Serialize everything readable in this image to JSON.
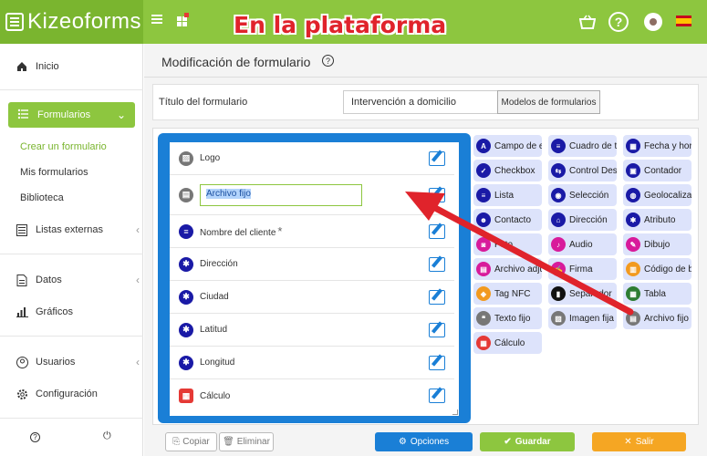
{
  "header": {
    "logo_text": "Kizeoforms",
    "overlay_title": "En la plataforma",
    "help_icon_label": "?"
  },
  "sidebar": {
    "items": [
      {
        "label": "Inicio",
        "icon": "home-icon"
      },
      {
        "label": "Formularios",
        "icon": "list-icon",
        "active": true
      },
      {
        "label": "Listas externas",
        "icon": "external-list-icon"
      },
      {
        "label": "Datos",
        "icon": "data-icon"
      },
      {
        "label": "Gráficos",
        "icon": "chart-icon"
      },
      {
        "label": "Usuarios",
        "icon": "user-icon"
      },
      {
        "label": "Configuración",
        "icon": "gear-icon"
      }
    ],
    "subitems": [
      "Crear un formulario",
      "Mis formularios",
      "Biblioteca"
    ],
    "footer_help": "?",
    "footer_power": "⏻"
  },
  "main": {
    "page_title": "Modificación de formulario",
    "form_title_label": "Título del formulario",
    "form_title_value": "Intervención a domicilio",
    "models_button": "Modelos de formularios"
  },
  "form_fields": [
    {
      "label": "Logo",
      "icon": "image-icon",
      "color": "#777777"
    },
    {
      "label": "Archivo fijo",
      "icon": "file-icon",
      "color": "#777777",
      "editing": true
    },
    {
      "label": "Nombre del cliente",
      "icon": "list-icon",
      "color": "#1a1aa6",
      "required": true,
      "required_mark": "*"
    },
    {
      "label": "Dirección",
      "icon": "asterisk-icon",
      "color": "#1a1aa6"
    },
    {
      "label": "Ciudad",
      "icon": "asterisk-icon",
      "color": "#1a1aa6"
    },
    {
      "label": "Latitud",
      "icon": "asterisk-icon",
      "color": "#1a1aa6"
    },
    {
      "label": "Longitud",
      "icon": "asterisk-icon",
      "color": "#1a1aa6"
    },
    {
      "label": "Cálculo",
      "icon": "calculator-icon",
      "color": "#e53935"
    }
  ],
  "palette": [
    {
      "label": "Campo de en",
      "icon": "text-icon",
      "color": "#1a1aa6",
      "glyph": "A"
    },
    {
      "label": "Cuadro de te",
      "icon": "textarea-icon",
      "color": "#1a1aa6",
      "glyph": "≡"
    },
    {
      "label": "Fecha y hora",
      "icon": "calendar-icon",
      "color": "#1a1aa6",
      "glyph": "▦"
    },
    {
      "label": "Checkbox",
      "icon": "checkbox-icon",
      "color": "#1a1aa6",
      "glyph": "✓"
    },
    {
      "label": "Control Desli",
      "icon": "slider-icon",
      "color": "#1a1aa6",
      "glyph": "⇆"
    },
    {
      "label": "Contador",
      "icon": "counter-icon",
      "color": "#1a1aa6",
      "glyph": "▣"
    },
    {
      "label": "Lista",
      "icon": "list-icon",
      "color": "#1a1aa6",
      "glyph": "≡"
    },
    {
      "label": "Selección",
      "icon": "select-icon",
      "color": "#1a1aa6",
      "glyph": "◉"
    },
    {
      "label": "Geolocalizaci",
      "icon": "globe-icon",
      "color": "#1a1aa6",
      "glyph": "◍"
    },
    {
      "label": "Contacto",
      "icon": "contact-icon",
      "color": "#1a1aa6",
      "glyph": "☻"
    },
    {
      "label": "Dirección",
      "icon": "address-icon",
      "color": "#1a1aa6",
      "glyph": "⌂"
    },
    {
      "label": "Atributo",
      "icon": "attribute-icon",
      "color": "#1a1aa6",
      "glyph": "✱"
    },
    {
      "label": "Foto",
      "icon": "camera-icon",
      "color": "#d81b9b",
      "glyph": "◙"
    },
    {
      "label": "Audio",
      "icon": "microphone-icon",
      "color": "#d81b9b",
      "glyph": "♪"
    },
    {
      "label": "Dibujo",
      "icon": "pencil-icon",
      "color": "#d81b9b",
      "glyph": "✎"
    },
    {
      "label": "Archivo adju",
      "icon": "attachment-icon",
      "color": "#d81b9b",
      "glyph": "▤"
    },
    {
      "label": "Firma",
      "icon": "signature-icon",
      "color": "#d81b9b",
      "glyph": "✍"
    },
    {
      "label": "Código de ba",
      "icon": "barcode-icon",
      "color": "#f29a1f",
      "glyph": "▥"
    },
    {
      "label": "Tag NFC",
      "icon": "nfc-icon",
      "color": "#f29a1f",
      "glyph": "◈"
    },
    {
      "label": "Separador",
      "icon": "bookmark-icon",
      "color": "#111111",
      "glyph": "▮"
    },
    {
      "label": "Tabla",
      "icon": "table-icon",
      "color": "#2e7d32",
      "glyph": "▦"
    },
    {
      "label": "Texto fijo",
      "icon": "quote-icon",
      "color": "#777777",
      "glyph": "❝"
    },
    {
      "label": "Imagen fija",
      "icon": "image-icon",
      "color": "#777777",
      "glyph": "▨"
    },
    {
      "label": "Archivo fijo",
      "icon": "file-icon",
      "color": "#777777",
      "glyph": "▤"
    },
    {
      "label": "Cálculo",
      "icon": "calculator-icon",
      "color": "#e53935",
      "glyph": "▦"
    }
  ],
  "footer_buttons": {
    "copy": "Copiar",
    "delete": "Eliminar",
    "options": "Opciones",
    "save": "Guardar",
    "exit": "Salir"
  },
  "colors": {
    "brand_green": "#8dc63f",
    "form_blue": "#1a7fd6",
    "arrow_red": "#e0232b",
    "exit_orange": "#f5a623"
  }
}
